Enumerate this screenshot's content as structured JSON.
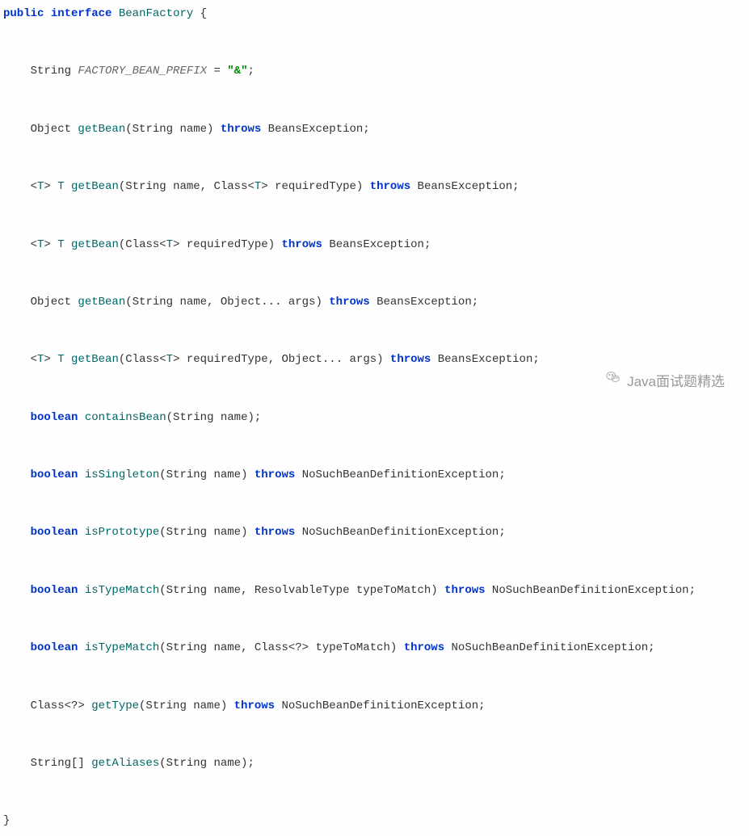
{
  "watermark": "Java面试题精选",
  "code": {
    "0": {
      "t0": "public",
      "t1": " ",
      "t2": "interface",
      "t3": " ",
      "t4": "BeanFactory",
      "t5": " {"
    },
    "2": {
      "t0": "    String ",
      "t1": "FACTORY_BEAN_PREFIX",
      "t2": " = ",
      "t3": "\"&\"",
      "t4": ";"
    },
    "4": {
      "t0": "    Object ",
      "t1": "getBean",
      "t2": "(String name) ",
      "t3": "throws",
      "t4": " BeansException;"
    },
    "6": {
      "t0": "    <",
      "t1": "T",
      "t2": "> ",
      "t3": "T",
      "t4": " ",
      "t5": "getBean",
      "t6": "(String name, Class<",
      "t7": "T",
      "t8": "> requiredType) ",
      "t9": "throws",
      "t10": " BeansException;"
    },
    "8": {
      "t0": "    <",
      "t1": "T",
      "t2": "> ",
      "t3": "T",
      "t4": " ",
      "t5": "getBean",
      "t6": "(Class<",
      "t7": "T",
      "t8": "> requiredType) ",
      "t9": "throws",
      "t10": " BeansException;"
    },
    "10": {
      "t0": "    Object ",
      "t1": "getBean",
      "t2": "(String name, Object... args) ",
      "t3": "throws",
      "t4": " BeansException;"
    },
    "12": {
      "t0": "    <",
      "t1": "T",
      "t2": "> ",
      "t3": "T",
      "t4": " ",
      "t5": "getBean",
      "t6": "(Class<",
      "t7": "T",
      "t8": "> requiredType, Object... args) ",
      "t9": "throws",
      "t10": " BeansException;"
    },
    "14": {
      "t0": "    ",
      "t1": "boolean",
      "t2": " ",
      "t3": "containsBean",
      "t4": "(String name);"
    },
    "16": {
      "t0": "    ",
      "t1": "boolean",
      "t2": " ",
      "t3": "isSingleton",
      "t4": "(String name) ",
      "t5": "throws",
      "t6": " NoSuchBeanDefinitionException;"
    },
    "18": {
      "t0": "    ",
      "t1": "boolean",
      "t2": " ",
      "t3": "isPrototype",
      "t4": "(String name) ",
      "t5": "throws",
      "t6": " NoSuchBeanDefinitionException;"
    },
    "20": {
      "t0": "    ",
      "t1": "boolean",
      "t2": " ",
      "t3": "isTypeMatch",
      "t4": "(String name, ResolvableType typeToMatch) ",
      "t5": "throws",
      "t6": " NoSuchBeanDefinitionException;"
    },
    "22": {
      "t0": "    ",
      "t1": "boolean",
      "t2": " ",
      "t3": "isTypeMatch",
      "t4": "(String name, Class<?> typeToMatch) ",
      "t5": "throws",
      "t6": " NoSuchBeanDefinitionException;"
    },
    "24": {
      "t0": "    Class<?> ",
      "t1": "getType",
      "t2": "(String name) ",
      "t3": "throws",
      "t4": " NoSuchBeanDefinitionException;"
    },
    "26": {
      "t0": "    String[] ",
      "t1": "getAliases",
      "t2": "(String name);"
    },
    "28": {
      "t0": "}"
    }
  }
}
